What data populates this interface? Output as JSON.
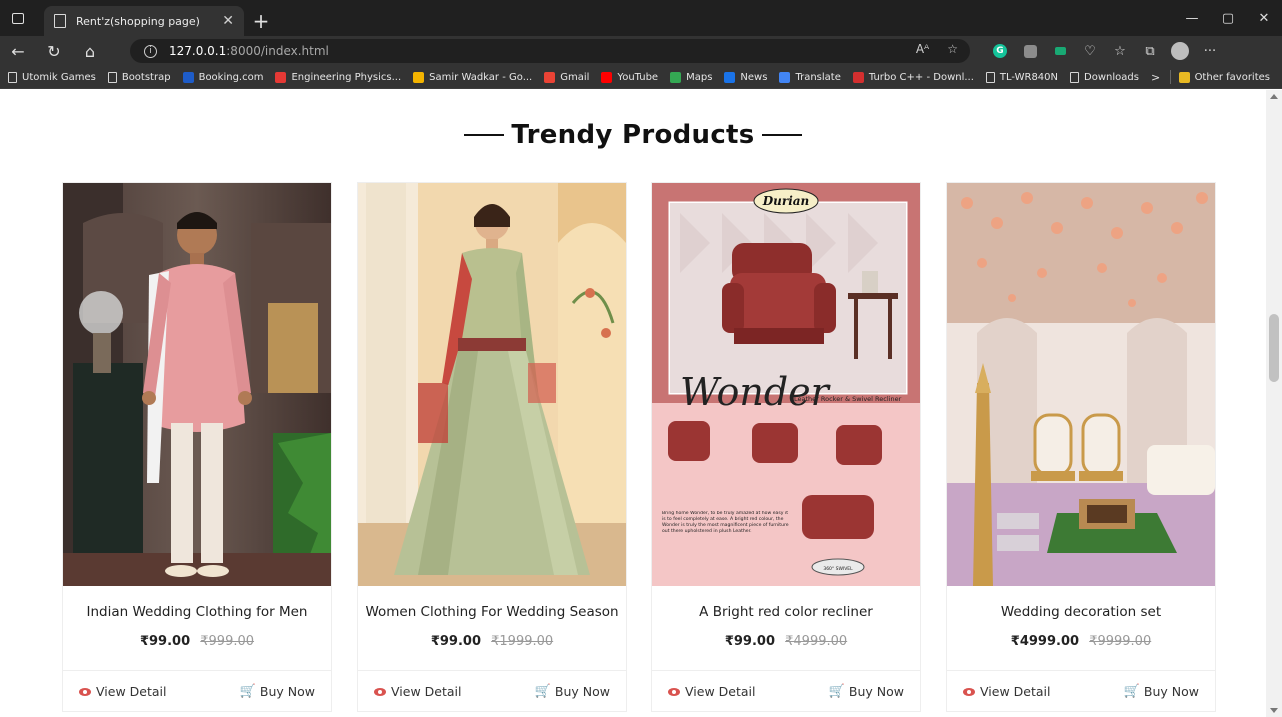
{
  "browser": {
    "tab_title": "Rent'z(shopping page)",
    "tab_close": "✕",
    "new_tab": "+",
    "url_host": "127.0.0.1",
    "url_path": ":8000/index.html",
    "window_controls": {
      "minimize": "—",
      "maximize": "▢",
      "close": "✕"
    }
  },
  "bookmarks": [
    {
      "label": "Utomik Games",
      "icon": "page-icon",
      "color": ""
    },
    {
      "label": "Bootstrap",
      "icon": "page-icon",
      "color": ""
    },
    {
      "label": "Booking.com",
      "icon": "booking-icon",
      "color": "#1e5cc8"
    },
    {
      "label": "Engineering Physics...",
      "icon": "pdf-icon",
      "color": "#e53935"
    },
    {
      "label": "Samir Wadkar - Go...",
      "icon": "drive-icon",
      "color": "#f4b400"
    },
    {
      "label": "Gmail",
      "icon": "gmail-icon",
      "color": "#ea4335"
    },
    {
      "label": "YouTube",
      "icon": "youtube-icon",
      "color": "#ff0000"
    },
    {
      "label": "Maps",
      "icon": "maps-icon",
      "color": "#34a853"
    },
    {
      "label": "News",
      "icon": "news-icon",
      "color": "#1a73e8"
    },
    {
      "label": "Translate",
      "icon": "translate-icon",
      "color": "#4285f4"
    },
    {
      "label": "Turbo C++ - Downl...",
      "icon": "turbo-icon",
      "color": "#d32f2f"
    },
    {
      "label": "TL-WR840N",
      "icon": "page-icon",
      "color": ""
    },
    {
      "label": "Downloads",
      "icon": "page-icon",
      "color": ""
    }
  ],
  "bookmarks_more": ">",
  "other_favorites": "Other favorites",
  "section": {
    "title": "Trendy Products"
  },
  "products": [
    {
      "name": "Indian Wedding Clothing for Men",
      "price": "₹99.00",
      "old_price": "₹999.00",
      "view_label": "View Detail",
      "buy_label": "Buy Now"
    },
    {
      "name": "Women Clothing For Wedding Season",
      "price": "₹99.00",
      "old_price": "₹1999.00",
      "view_label": "View Detail",
      "buy_label": "Buy Now"
    },
    {
      "name": "A Bright red color recliner",
      "price": "₹99.00",
      "old_price": "₹4999.00",
      "view_label": "View Detail",
      "buy_label": "Buy Now"
    },
    {
      "name": "Wedding decoration set",
      "price": "₹4999.00",
      "old_price": "₹9999.00",
      "view_label": "View Detail",
      "buy_label": "Buy Now"
    }
  ],
  "recliner_ad": {
    "brand": "Durian",
    "headline": "Wonder",
    "tagline": "Leather Rocker & Swivel Recliner",
    "copy": "Bring home Wonder, to be truly amazed at how easy it is to feel completely at ease. A bright red colour, the Wonder is truly the most magnificent piece of furniture out there upholstered in plush Leather.",
    "swivel_label": "360° SWIVEL"
  },
  "colors": {
    "accent": "#d9534f",
    "chrome_dark": "#202020",
    "chrome_mid": "#333333"
  }
}
